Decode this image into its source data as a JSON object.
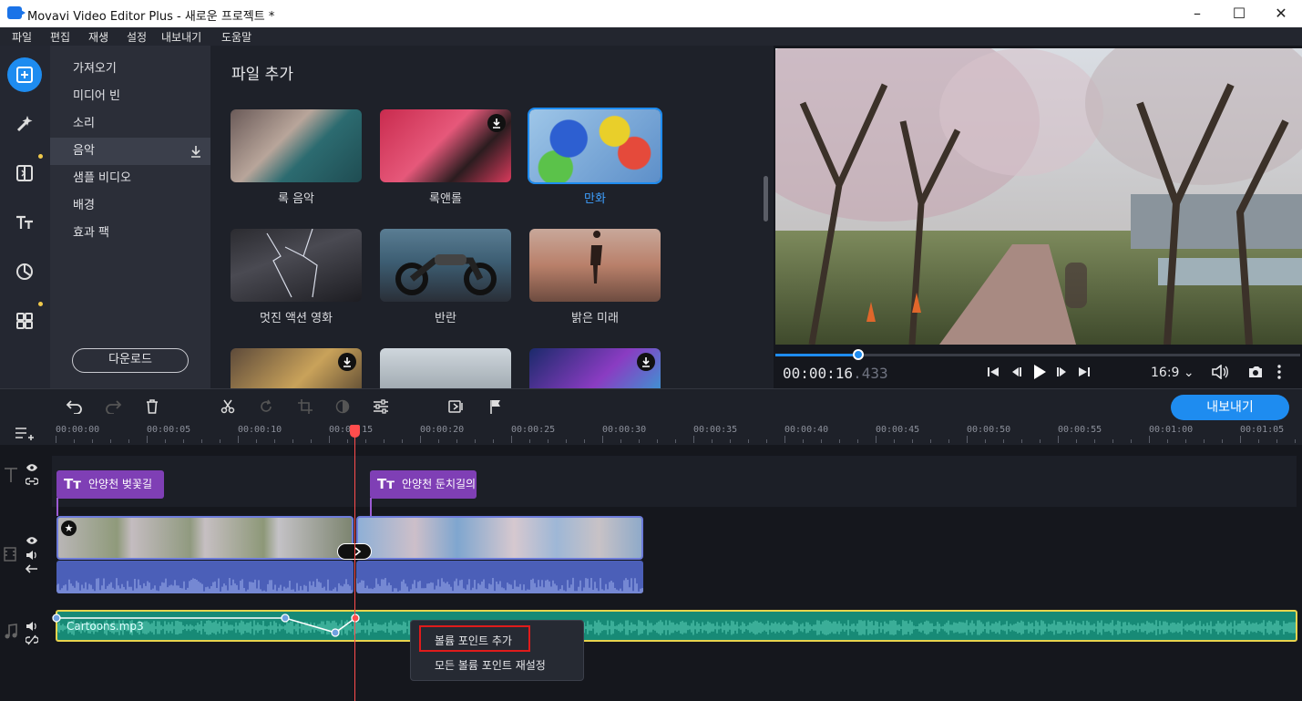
{
  "window": {
    "title": "Movavi Video Editor Plus - 새로운 프로젝트 *"
  },
  "menu": [
    "파일",
    "편집",
    "재생",
    "설정",
    "내보내기",
    "도움말"
  ],
  "categories": {
    "items": [
      {
        "label": "가져오기"
      },
      {
        "label": "미디어 빈"
      },
      {
        "label": "소리"
      },
      {
        "label": "음악"
      },
      {
        "label": "샘플 비디오"
      },
      {
        "label": "배경"
      },
      {
        "label": "효과 팩"
      }
    ],
    "download_label": "다운로드"
  },
  "content": {
    "title": "파일 추가",
    "tiles": [
      {
        "label": "록 음악",
        "selected": false,
        "download": false
      },
      {
        "label": "록앤롤",
        "selected": false,
        "download": true
      },
      {
        "label": "만화",
        "selected": true,
        "download": false
      },
      {
        "label": "멋진 액션 영화",
        "selected": false,
        "download": false
      },
      {
        "label": "반란",
        "selected": false,
        "download": false
      },
      {
        "label": "밝은 미래",
        "selected": false,
        "download": false
      }
    ]
  },
  "player": {
    "timecode_main": "00:00:16",
    "timecode_ms": ".433",
    "aspect": "16:9",
    "progress": 0.156
  },
  "timeline": {
    "export_label": "내보내기",
    "ruler": [
      "00:00:00",
      "00:00:05",
      "00:00:10",
      "00:00:15",
      "00:00:20",
      "00:00:25",
      "00:00:30",
      "00:00:35",
      "00:00:40",
      "00:00:45",
      "00:00:50",
      "00:00:55",
      "00:01:00",
      "00:01:05"
    ],
    "title_clips": [
      "안양천 벚꽃길",
      "안양천 둔치길의"
    ],
    "music_clip": "Cartoons.mp3"
  },
  "context_menu": {
    "items": [
      "볼륨 포인트 추가",
      "모든 볼륨 포인트 재설정"
    ]
  },
  "colors": {
    "accent": "#1e8cf0",
    "title_clip": "#7f3fb5",
    "music_clip": "#178a76",
    "playhead": "#ff4d4d"
  }
}
